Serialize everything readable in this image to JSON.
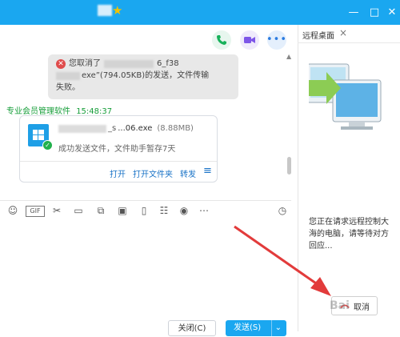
{
  "colors": {
    "accent": "#1aa7f0",
    "sender": "#179e3a",
    "link": "#1a73c7",
    "error": "#e04c4c",
    "arrow": "#e23b3b"
  },
  "titlebar": {
    "minimize_icon": "minimize-icon",
    "maximize_icon": "maximize-icon",
    "close_icon": "close-icon"
  },
  "chat_header": {
    "call_icon": "phone-icon",
    "video_icon": "video-icon",
    "more_icon": "more-icon"
  },
  "notice": {
    "line1": "您取消了",
    "line1_tail": "6_f38",
    "line2": "exe”(794.05KB)的发送，文件传输",
    "line3": "失败。"
  },
  "message": {
    "sender": "专业会员管理软件",
    "time": "15:48:37",
    "file_name": "...06.exe",
    "file_name_prefix": "_s",
    "file_size": "(8.88MB)",
    "status": "成功发送文件，文件助手暂存7天",
    "actions": {
      "open": "打开",
      "open_folder": "打开文件夹",
      "forward": "转发"
    }
  },
  "toolbar_icons": [
    "emoji-icon",
    "gif-icon",
    "scissors-icon",
    "folder-icon",
    "doc-icon",
    "image-icon",
    "shake-icon",
    "calendar-icon",
    "music-icon",
    "more-icon",
    "history-icon"
  ],
  "right_panel": {
    "tab_title": "远程桌面",
    "tab_close": "×",
    "request_text": "您正在请求远程控制大海的电脑，请等待对方回应...",
    "cancel_label": "取消"
  },
  "bottom": {
    "close_label": "关闭(C)",
    "send_label": "发送(S)"
  },
  "watermark": "Bai"
}
